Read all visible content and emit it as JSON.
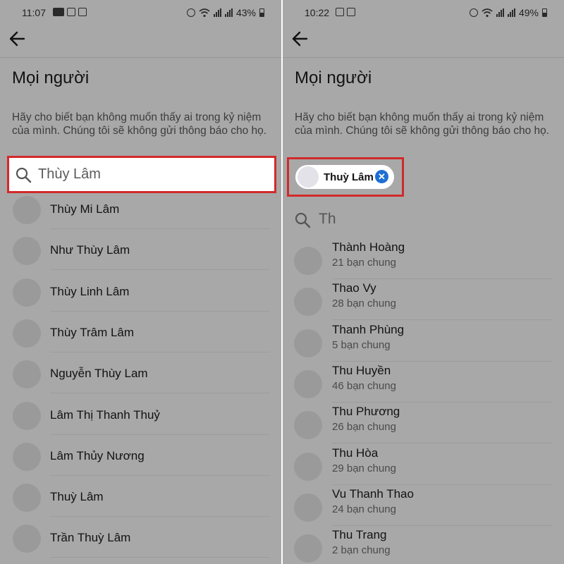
{
  "left": {
    "status": {
      "time": "11:07",
      "battery": "43%"
    },
    "title": "Mọi người",
    "description": "Hãy cho biết bạn không muốn thấy ai trong kỷ niệm của mình. Chúng tôi sẽ không gửi thông báo cho họ.",
    "search_value": "Thùy Lâm",
    "results": [
      "Thùy Mi Lâm",
      "Như Thùy Lâm",
      "Thùy Linh Lâm",
      "Thùy Trâm Lâm",
      "Nguyễn Thùy Lam",
      "Lâm Thị Thanh Thuỷ",
      "Lâm Thủy Nương",
      "Thuỳ Lâm",
      "Trần Thuỳ Lâm"
    ]
  },
  "right": {
    "status": {
      "time": "10:22",
      "battery": "49%"
    },
    "title": "Mọi người",
    "description": "Hãy cho biết bạn không muốn thấy ai trong kỷ niệm của mình. Chúng tôi sẽ không gửi thông báo cho họ.",
    "chip_name": "Thuỳ Lâm",
    "query": "Th",
    "friends": [
      {
        "name": "Thành Hoàng",
        "mutual": "21 bạn chung"
      },
      {
        "name": "Thao Vy",
        "mutual": "28 bạn chung"
      },
      {
        "name": "Thanh Phùng",
        "mutual": "5 bạn chung"
      },
      {
        "name": "Thu Huyền",
        "mutual": "46 bạn chung"
      },
      {
        "name": "Thu Phương",
        "mutual": "26 bạn chung"
      },
      {
        "name": "Thu Hòa",
        "mutual": "29 bạn chung"
      },
      {
        "name": "Vu Thanh Thao",
        "mutual": "24 bạn chung"
      },
      {
        "name": "Thu Trang",
        "mutual": "2 bạn chung"
      }
    ]
  },
  "colors": {
    "overlay": "#a8a8a8",
    "highlight": "#d22a2a",
    "chip_remove": "#1d6fd4"
  },
  "icons": [
    "back-arrow-icon",
    "search-icon",
    "close-icon",
    "alarm-icon",
    "wifi-icon",
    "signal-icon",
    "battery-icon"
  ]
}
